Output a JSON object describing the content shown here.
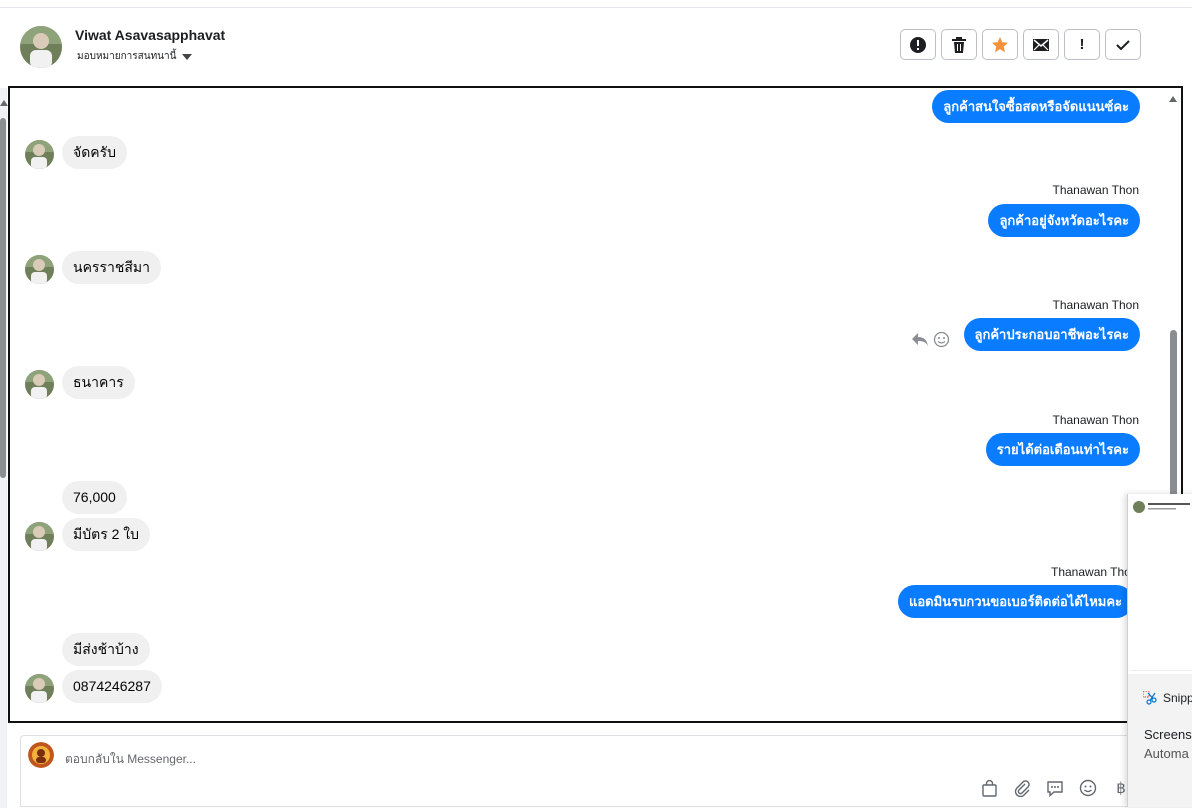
{
  "header": {
    "contact_name": "Viwat Asavasapphavat",
    "assign_label": "มอบหมายการสนทนานี้",
    "actions": [
      {
        "icon": "alert-circle-icon",
        "glyph": "!"
      },
      {
        "icon": "trash-icon",
        "glyph": "🗑"
      },
      {
        "icon": "star-icon",
        "glyph": "★"
      },
      {
        "icon": "envelope-icon",
        "glyph": "✉"
      },
      {
        "icon": "exclamation-icon",
        "glyph": "!"
      },
      {
        "icon": "check-icon",
        "glyph": "✓"
      }
    ]
  },
  "messages": [
    {
      "dir": "out",
      "text": "ลูกค้าสนใจซื้อสดหรือจัดแนนซ์คะ"
    },
    {
      "dir": "in",
      "text": "จัดครับ"
    },
    {
      "dir": "out",
      "sender": "Thanawan Thon",
      "text": "ลูกค้าอยู่จังหวัดอะไรคะ"
    },
    {
      "dir": "in",
      "text": "นครราชสีมา"
    },
    {
      "dir": "out",
      "sender": "Thanawan Thon",
      "text": "ลูกค้าประกอบอาชีพอะไรคะ"
    },
    {
      "dir": "in",
      "text": "ธนาคาร"
    },
    {
      "dir": "out",
      "sender": "Thanawan Thon",
      "text": "รายได้ต่อเดือนเท่าไรคะ"
    },
    {
      "dir": "in",
      "text": "76,000"
    },
    {
      "dir": "in",
      "text": "มีบัตร 2 ใบ"
    },
    {
      "dir": "out",
      "sender": "Thanawan Thon",
      "text": "แอดมินรบกวนขอเบอร์ติดต่อได้ไหมคะ"
    },
    {
      "dir": "in",
      "text": "มีส่งช้าบ้าง"
    },
    {
      "dir": "in",
      "text": "0874246287"
    }
  ],
  "colors": {
    "outgoing_bubble": "#0a7cff",
    "incoming_bubble": "#f0f0f0",
    "star": "#f7923a"
  },
  "reply": {
    "placeholder": "ตอบกลับใน Messenger...",
    "tools": [
      "shopping-bag-icon",
      "paperclip-icon",
      "saved-reply-icon",
      "emoji-icon",
      "baht-icon"
    ],
    "baht_glyph": "฿"
  },
  "snip": {
    "app": "Snipp",
    "title": "Screensh",
    "subtitle": "Automa"
  }
}
